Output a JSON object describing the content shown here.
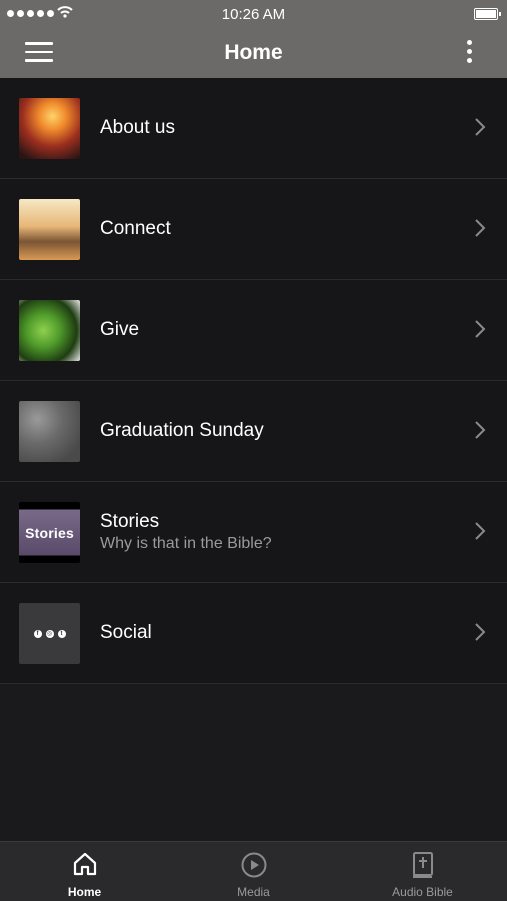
{
  "status_bar": {
    "time": "10:26 AM"
  },
  "nav": {
    "title": "Home"
  },
  "items": [
    {
      "title": "About us",
      "subtitle": ""
    },
    {
      "title": "Connect",
      "subtitle": ""
    },
    {
      "title": "Give",
      "subtitle": ""
    },
    {
      "title": "Graduation Sunday",
      "subtitle": ""
    },
    {
      "title": "Stories",
      "subtitle": "Why is that in the Bible?",
      "thumb_text": "Stories"
    },
    {
      "title": "Social",
      "subtitle": ""
    }
  ],
  "tabs": [
    {
      "label": "Home",
      "icon": "home-icon",
      "active": true
    },
    {
      "label": "Media",
      "icon": "play-icon",
      "active": false
    },
    {
      "label": "Audio Bible",
      "icon": "bible-icon",
      "active": false
    }
  ],
  "colors": {
    "header": "#6b6a68",
    "background": "#161618",
    "tab_bar": "#2a2a2c"
  }
}
